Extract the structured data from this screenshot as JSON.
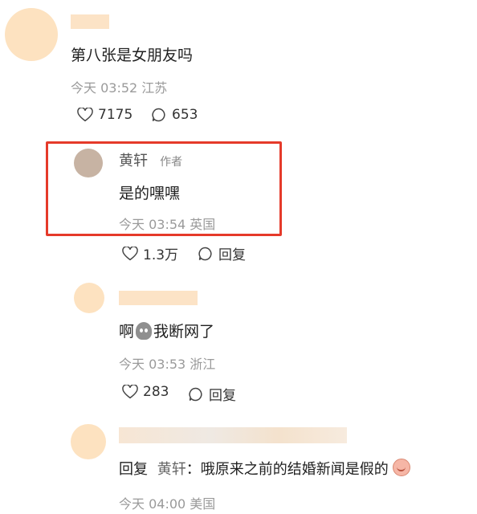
{
  "comments": [
    {
      "text": "第八张是女朋友吗",
      "time": "今天 03:52",
      "location": "江苏",
      "likes": "7175",
      "replies": "653"
    },
    {
      "author": "黄轩",
      "author_tag": "作者",
      "text": "是的嘿嘿",
      "time": "今天 03:54",
      "location": "英国",
      "likes": "1.3万",
      "reply_label": "回复"
    },
    {
      "text_before": "啊",
      "text_after": "我断网了",
      "emoji": "ghost-emoji",
      "time": "今天 03:53",
      "location": "浙江",
      "likes": "283",
      "reply_label": "回复"
    },
    {
      "reply_prefix": "回复",
      "reply_to": "黄轩",
      "text": "：哦原来之前的结婚新闻是假的",
      "emoji": "embarrassed-face-emoji",
      "time": "今天 04:00",
      "location": "美国"
    }
  ],
  "colors": {
    "highlight_box": "#e53a2a",
    "avatar_placeholder": "#fde2c0",
    "meta_text": "#9a9a9a"
  }
}
